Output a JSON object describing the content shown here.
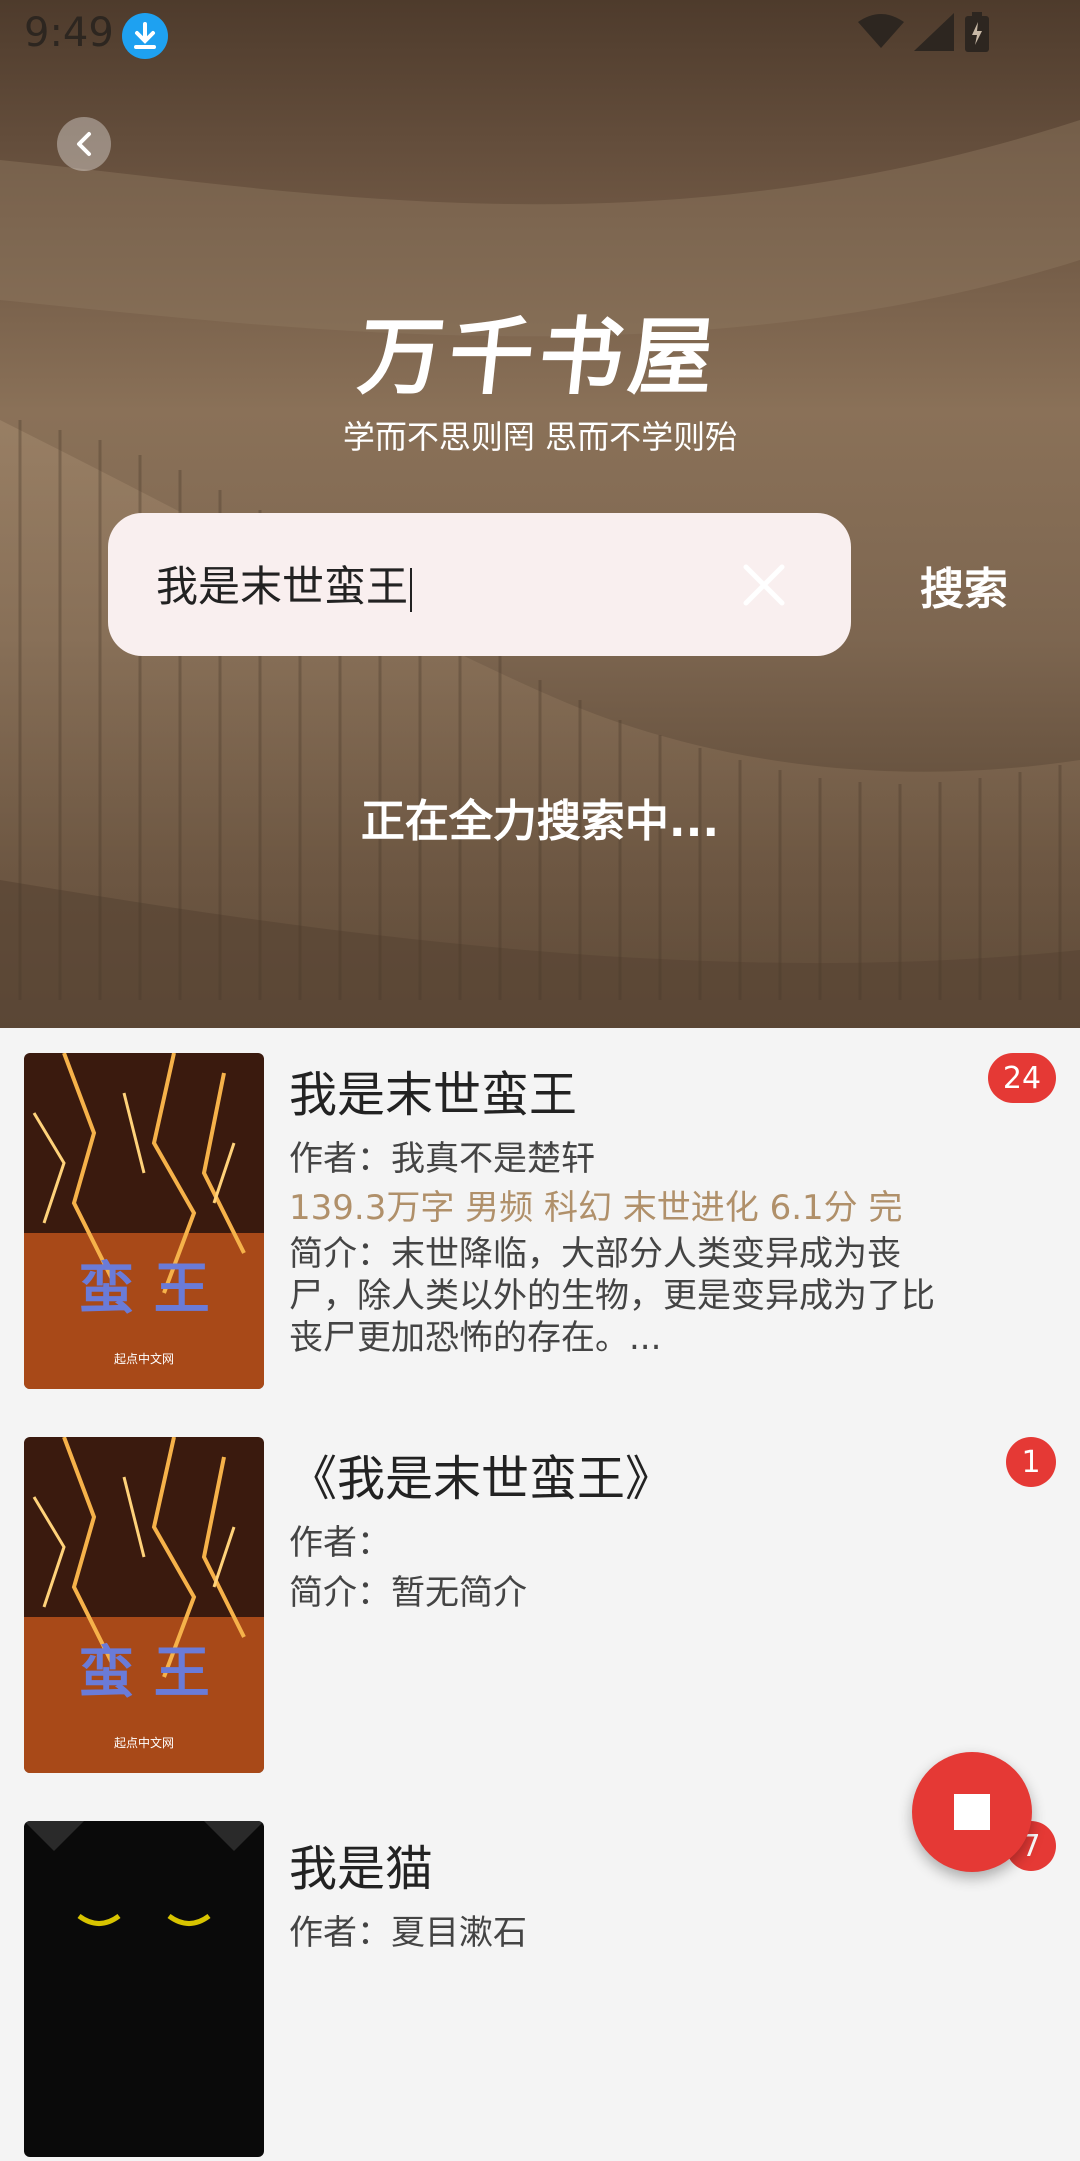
{
  "status_bar": {
    "time": "9:49"
  },
  "header": {
    "logo": "万千书屋",
    "slogan": "学而不思则罔 思而不学则殆"
  },
  "search": {
    "query": "我是末世蛮王",
    "button_label": "搜索",
    "status_text": "正在全力搜索中..."
  },
  "results": [
    {
      "title": "我是末世蛮王",
      "author": "作者：我真不是楚轩",
      "meta": "139.3万字  男频  科幻  末世进化  6.1分  完",
      "intro": "简介：末世降临，大部分人类变异成为丧尸，除人类以外的生物，更是变异成为了比丧尸更加恐怖的存在。...",
      "count": "24"
    },
    {
      "title": "《我是末世蛮王》",
      "author": "作者：",
      "intro": "简介：暂无简介",
      "count": "1"
    },
    {
      "title": "我是猫",
      "author": "作者：夏目漱石",
      "count": "7"
    }
  ],
  "fab": {
    "icon": "stop-icon"
  },
  "colors": {
    "accent": "#e53935",
    "meta_text": "#b0906a",
    "search_box": "#f9efef"
  }
}
